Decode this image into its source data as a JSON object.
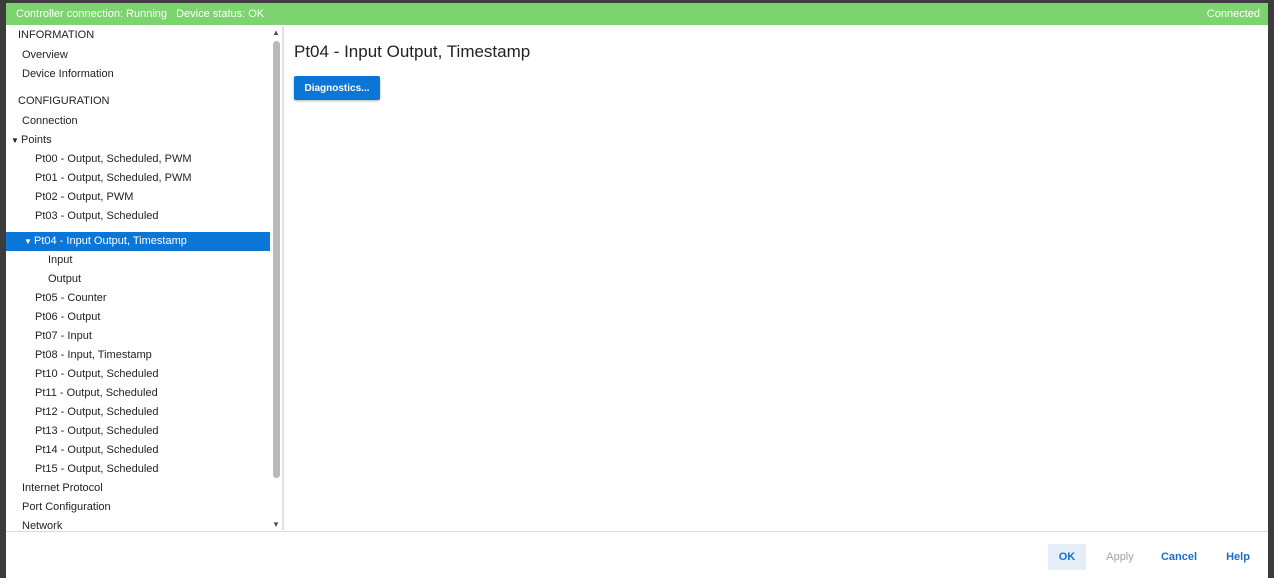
{
  "status_bar": {
    "connection_text": "Controller connection: Running",
    "device_status_text": "Device status: OK",
    "right_text": "Connected",
    "color": "#7dd36f"
  },
  "tree": {
    "sections": {
      "information": "INFORMATION",
      "configuration": "CONFIGURATION"
    },
    "items": {
      "overview": "Overview",
      "device_information": "Device Information",
      "connection": "Connection",
      "points": "Points",
      "pt00": "Pt00 - Output, Scheduled, PWM",
      "pt01": "Pt01 - Output, Scheduled, PWM",
      "pt02": "Pt02 - Output, PWM",
      "pt03": "Pt03 - Output, Scheduled",
      "pt04": "Pt04 - Input Output, Timestamp",
      "pt04_input": "Input",
      "pt04_output": "Output",
      "pt05": "Pt05 - Counter",
      "pt06": "Pt06 - Output",
      "pt07": "Pt07 - Input",
      "pt08": "Pt08 - Input, Timestamp",
      "pt10": "Pt10 - Output, Scheduled",
      "pt11": "Pt11 - Output, Scheduled",
      "pt12": "Pt12 - Output, Scheduled",
      "pt13": "Pt13 - Output, Scheduled",
      "pt14": "Pt14 - Output, Scheduled",
      "pt15": "Pt15 - Output, Scheduled",
      "internet_protocol": "Internet Protocol",
      "port_configuration": "Port Configuration",
      "network": "Network"
    },
    "selected_color": "#0a76d8"
  },
  "content": {
    "title": "Pt04 - Input Output, Timestamp",
    "diagnostics_label": "Diagnostics..."
  },
  "footer": {
    "ok": "OK",
    "apply": "Apply",
    "cancel": "Cancel",
    "help": "Help"
  },
  "icons": {
    "expand": "▼",
    "scroll_up": "▲",
    "scroll_down": "▼"
  }
}
